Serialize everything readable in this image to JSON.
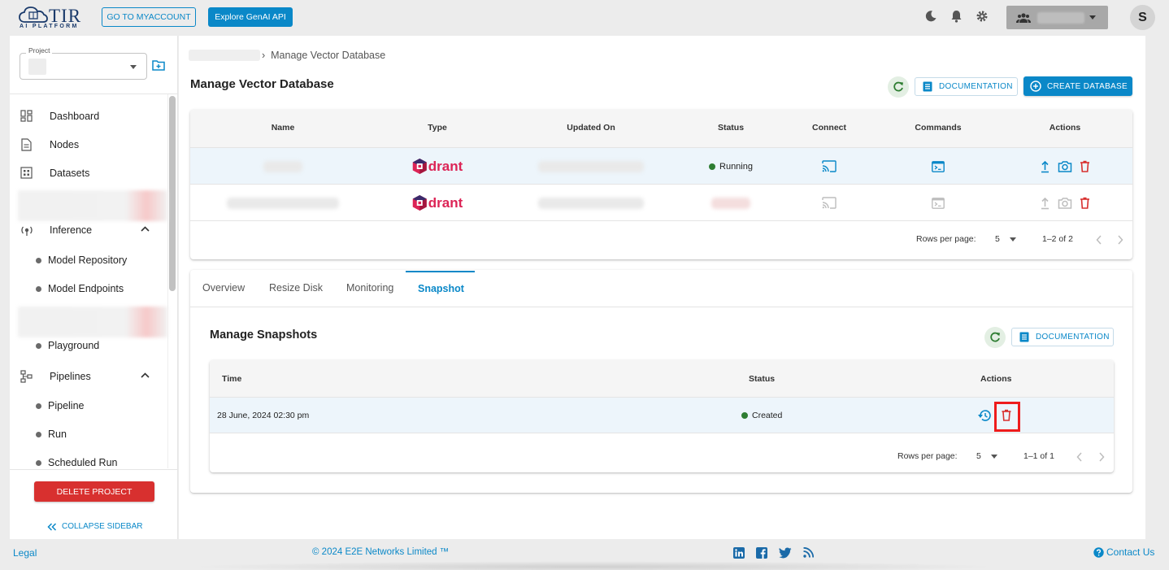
{
  "topbar": {
    "logo_title": "TIR",
    "logo_subtitle": "AI PLATFORM",
    "myaccount_button": "GO TO MYACCOUNT",
    "genai_button": "Explore GenAI API",
    "avatar_initial": "S",
    "icons": [
      "moon-icon",
      "bell-icon",
      "gear-icon",
      "team-icon",
      "chevron-down-icon"
    ]
  },
  "sidebar": {
    "project_label": "Project",
    "items": [
      {
        "label": "Dashboard",
        "icon": "dashboard-icon"
      },
      {
        "label": "Nodes",
        "icon": "document-icon"
      },
      {
        "label": "Datasets",
        "icon": "grid-icon"
      },
      {
        "label": "Inference",
        "icon": "inference-icon"
      },
      {
        "label": "Model Repository"
      },
      {
        "label": "Model Endpoints"
      },
      {
        "label": "Playground"
      },
      {
        "label": "Pipelines",
        "icon": "pipelines-icon"
      },
      {
        "label": "Pipeline"
      },
      {
        "label": "Run"
      },
      {
        "label": "Scheduled Run"
      }
    ],
    "delete_project": "DELETE PROJECT",
    "collapse": "COLLAPSE SIDEBAR"
  },
  "main": {
    "breadcrumb_sep": "›",
    "breadcrumb_current": "Manage Vector Database",
    "title": "Manage Vector Database",
    "documentation_label": "DOCUMENTATION",
    "create_label": "CREATE DATABASE",
    "table": {
      "columns": [
        "Name",
        "Type",
        "Updated On",
        "Status",
        "Connect",
        "Commands",
        "Actions"
      ],
      "rows": [
        {
          "type": "drant",
          "status": "Running"
        },
        {
          "type": "drant",
          "status": ""
        }
      ],
      "rows_per_page_label": "Rows per page:",
      "rows_per_page": "5",
      "range": "1–2 of 2"
    },
    "tabs": [
      "Overview",
      "Resize Disk",
      "Monitoring",
      "Snapshot"
    ],
    "active_tab": "Snapshot",
    "snapshots": {
      "title": "Manage Snapshots",
      "documentation_label": "DOCUMENTATION",
      "columns": [
        "Time",
        "Status",
        "Actions"
      ],
      "rows": [
        {
          "time": "28 June, 2024 02:30 pm",
          "status": "Created"
        }
      ],
      "rows_per_page_label": "Rows per page:",
      "rows_per_page": "5",
      "range": "1–1 of 1"
    }
  },
  "footer": {
    "legal": "Legal",
    "copyright": "© 2024 E2E Networks Limited ™",
    "contact": "Contact Us",
    "social": [
      "linkedin-icon",
      "facebook-icon",
      "twitter-icon",
      "rss-icon"
    ]
  },
  "colors": {
    "primary": "#0a88c8",
    "danger": "#d8302f",
    "success": "#2e7d32",
    "qdrant": "#dc2456",
    "highlight": "#ee1c1c"
  }
}
